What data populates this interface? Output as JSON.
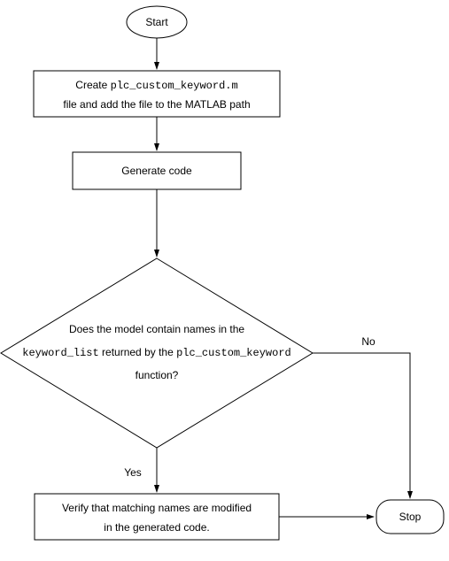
{
  "flowchart": {
    "start": "Start",
    "step1_line1a": "Create ",
    "step1_line1b": "plc_custom_keyword.m",
    "step1_line2": "file and add the file to the MATLAB path",
    "step2": "Generate code",
    "decision_line1": "Does the model contain names in the",
    "decision_line2a": "keyword_list",
    "decision_line2b": " returned by the ",
    "decision_line2c": "plc_custom_keyword",
    "decision_line3": "function?",
    "branch_yes": "Yes",
    "branch_no": "No",
    "step3_line1": "Verify that matching names are modified",
    "step3_line2": "in the generated code.",
    "stop": "Stop"
  }
}
